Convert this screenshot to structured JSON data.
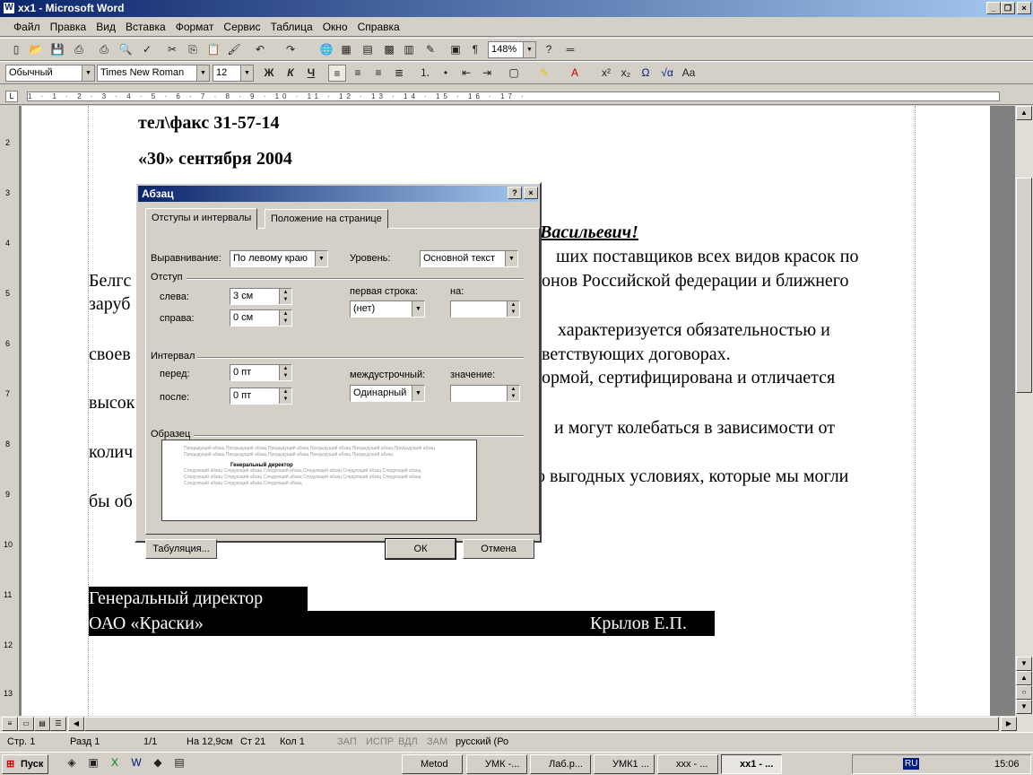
{
  "window": {
    "title": "xx1 - Microsoft Word",
    "icon": "word-icon",
    "controls": [
      "minimize-icon",
      "restore-icon",
      "close-icon"
    ]
  },
  "menu": [
    "Файл",
    "Правка",
    "Вид",
    "Вставка",
    "Формат",
    "Сервис",
    "Таблица",
    "Окно",
    "Справка"
  ],
  "toolbar_std": {
    "zoom": "148%",
    "icons": [
      "new-icon",
      "open-icon",
      "save-icon",
      "permission-icon",
      "print-icon",
      "print-preview-icon",
      "spelling-icon",
      "cut-icon",
      "copy-icon",
      "paste-icon",
      "format-painter-icon",
      "undo-icon",
      "redo-icon",
      "hyperlink-icon",
      "tables-borders-icon",
      "insert-table-icon",
      "excel-icon",
      "columns-icon",
      "drawing-icon",
      "document-map-icon",
      "show-hide-icon",
      "help-icon"
    ]
  },
  "toolbar_fmt": {
    "style": "Обычный",
    "font": "Times New Roman",
    "size": "12",
    "bold": "Ж",
    "italic": "К",
    "underline": "Ч",
    "icons": [
      "align-left-icon",
      "center-icon",
      "align-right-icon",
      "justify-icon",
      "numbering-icon",
      "bullets-icon",
      "decrease-indent-icon",
      "increase-indent-icon",
      "borders-icon",
      "highlight-icon",
      "font-color-icon",
      "superscript-icon",
      "subscript-icon",
      "symbol-icon",
      "equation-icon",
      "change-case-icon"
    ]
  },
  "ruler": {
    "ticks": "1 · 1 · 2 · 3 · 4 · 5 · 6 · 7 · 8 · 9 · 10 · 11 · 12 · 13 · 14 · 15 · 16 · 17 ·",
    "vnumbers": [
      "2",
      "3",
      "4",
      "5",
      "6",
      "7",
      "8",
      "9",
      "10",
      "11",
      "12",
      "13"
    ]
  },
  "document": {
    "phone": "тел\\факс 31-57-14",
    "date": "«30»  сентября  2004",
    "greeting": "Васильевич!",
    "line1": "ших поставщиков всех видов красок по",
    "line2a": "Белгс",
    "line2b": "онов Российской федерации и ближнего",
    "line3": "заруб",
    "line4": "характеризуется   обязательностью   и",
    "line5a": "своев",
    "line5b": "ветствующих договорах.",
    "line6": "ормой,  сертифицирована  и  отличается",
    "line7": "высок",
    "line8": "и  могут  колебаться  в  зависимости  от",
    "line9": "колич",
    "line10": "о выгодных условиях, которые мы могли",
    "line11": "бы об",
    "sig_title": "Генеральный директор",
    "sig_org": "ОАО  «Краски»",
    "sig_name": "Крылов Е.П."
  },
  "dialog": {
    "title": "Абзац",
    "help": "?",
    "close": "×",
    "tab1": "Отступы и интервалы",
    "tab2": "Положение на странице",
    "align_label": "Выравнивание:",
    "align_value": "По левому краю",
    "level_label": "Уровень:",
    "level_value": "Основной текст",
    "indent_group": "Отступ",
    "left_label": "слева:",
    "left_value": "3 см",
    "right_label": "справа:",
    "right_value": "0 см",
    "first_label": "первая строка:",
    "first_value": "(нет)",
    "by_label": "на:",
    "by_value": "",
    "spacing_group": "Интервал",
    "before_label": "перед:",
    "before_value": "0 пт",
    "after_label": "после:",
    "after_value": "0 пт",
    "line_label": "междустрочный:",
    "line_value": "Одинарный",
    "at_label": "значение:",
    "at_value": "",
    "sample_group": "Образец",
    "sample_prev": "Предыдущий абзац Предыдущий абзац Предыдущий абзац Предыдущий абзац Предыдущий абзац Предыдущий абзац Предыдущий абзац Предыдущий абзац Предыдущий абзац Предыдущий абзац Предыдущий абзац",
    "sample_cur": "Генеральный директор",
    "sample_next": "Следующий абзац Следующий абзац Следующий абзац Следующий абзац Следующий абзац Следующий абзац Следующий абзац Следующий абзац Следующий абзац Следующий абзац Следующий абзац Следующий абзац Следующий абзац Следующий абзац Следующий абзац",
    "tabs_button": "Табуляция...",
    "ok": "ОК",
    "cancel": "Отмена"
  },
  "statusbar": {
    "page": "Стр. 1",
    "section": "Разд 1",
    "pages": "1/1",
    "at": "На 12,9см",
    "line": "Ст 21",
    "col": "Кол 1",
    "rec": "ЗАП",
    "trk": "ИСПР",
    "ext": "ВДЛ",
    "ovr": "ЗАМ",
    "lang": "русский (Ро"
  },
  "taskbar": {
    "start": "Пуск",
    "buttons": [
      "Metod",
      "УМК -...",
      "Лаб.р...",
      "УМК1 ...",
      "xxx - ...",
      "xx1 - ..."
    ],
    "tray_lang": "RU",
    "clock": "15:06"
  }
}
